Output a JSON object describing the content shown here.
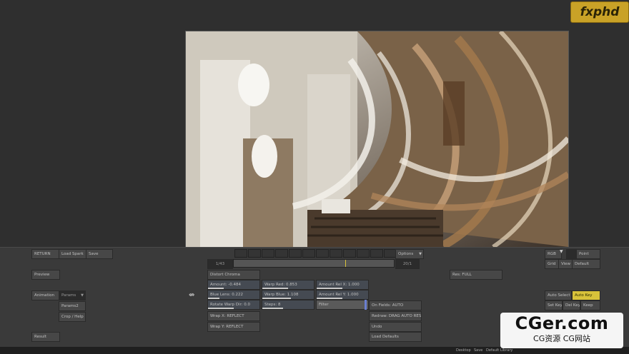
{
  "logo": {
    "text": "fxphd"
  },
  "left_panel": {
    "return": "RETURN",
    "load_spark": "Load Spark",
    "save": "Save",
    "preview": "Preview",
    "animation": "Animation",
    "params": "Params",
    "params2": "Params2",
    "crop_help": "Crop / Help",
    "result": "Result"
  },
  "timeline": {
    "options": "Options",
    "start": "1/43",
    "end": "20/1"
  },
  "params": {
    "distort_chroma": "Distort Chroma",
    "amount": "Amount: -0.484",
    "warp_red": "Warp Red: 0.853",
    "amount_rel_x": "Amount Rel X: 1.000",
    "blue_lens": "Blue Lens: 0.222",
    "warp_blue": "Warp Blue: 1.108",
    "amount_rel_y": "Amount Rel Y: 1.000",
    "rotate_warp": "Rotate Warp Dir: 0.0",
    "steps": "Steps: 8",
    "filter": "Filter",
    "wrap_x": "Wrap X: REFLECT",
    "wrap_y": "Wrap Y: REFLECT",
    "on_fields": "On Fields: AUTO",
    "redraw": "Redraw: DRAG AUTO RES",
    "undo": "Undo",
    "load_defaults": "Load Defaults",
    "res": "Res: FULL"
  },
  "right_panel": {
    "rgb": "RGB",
    "point": "Point",
    "grid": "Grid",
    "view": "View",
    "default": "Default",
    "auto_select": "Auto Select",
    "auto_key": "Auto Key",
    "set_key": "Set Key",
    "del_key": "Del Key",
    "keep": "Keep"
  },
  "status": {
    "desktop": "Desktop",
    "save": "Save",
    "library": "Default Library"
  },
  "watermark": {
    "line1": "CGer.com",
    "line2": "CG资源 CG网站"
  }
}
